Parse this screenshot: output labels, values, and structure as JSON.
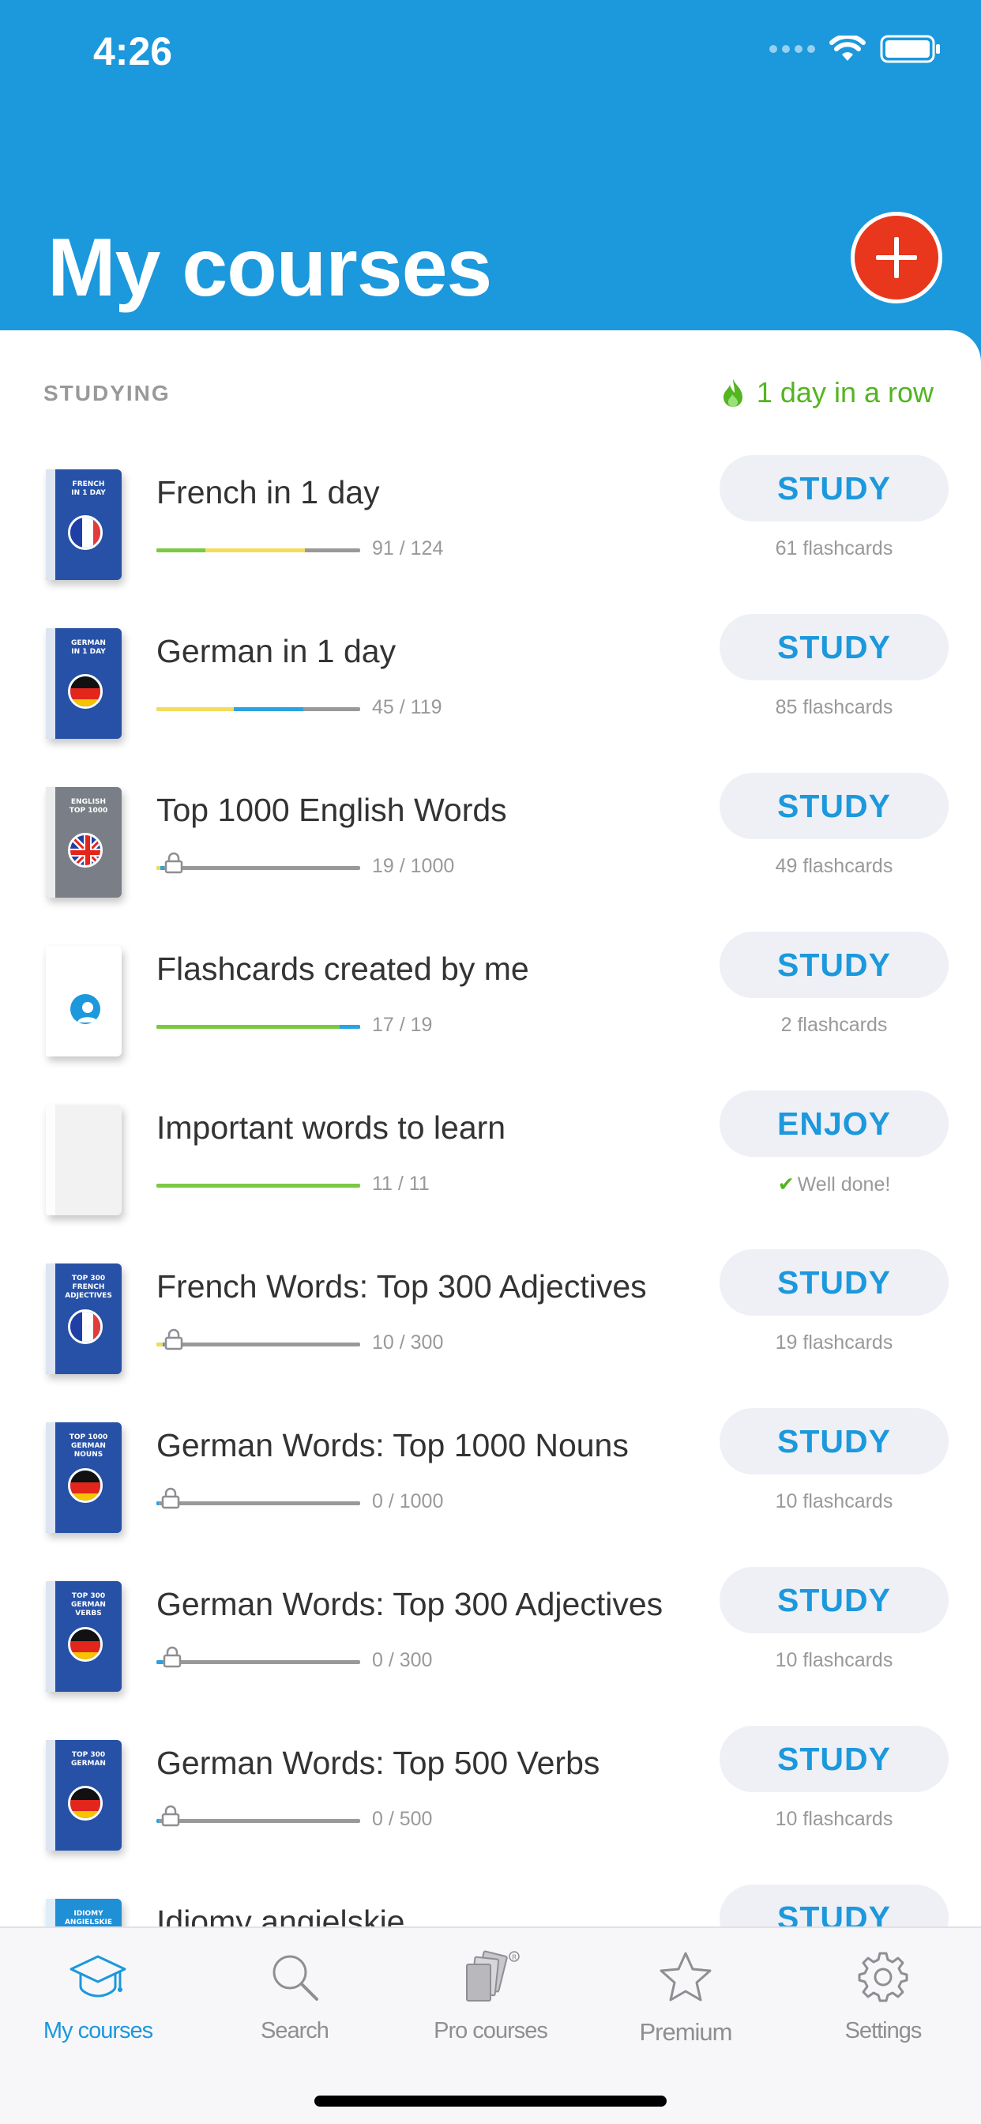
{
  "status_bar": {
    "time": "4:26"
  },
  "header": {
    "title": "My courses",
    "add_icon": "plus-icon"
  },
  "section": {
    "label": "STUDYING",
    "streak": "1 day in a row",
    "streak_color": "#53b51f"
  },
  "courses": [
    {
      "name": "French in 1 day",
      "count": "91 / 124",
      "action": "STUDY",
      "sub": "61 flashcards",
      "cover": {
        "color": "#2651a6",
        "title": "FRENCH\nIN 1 DAY",
        "flag": "fr"
      },
      "progress": [
        {
          "c": "#7ac943",
          "f": 0.24
        },
        {
          "c": "#f3dc5b",
          "f": 0.49
        }
      ],
      "locked": false
    },
    {
      "name": "German in 1 day",
      "count": "45 / 119",
      "action": "STUDY",
      "sub": "85 flashcards",
      "cover": {
        "color": "#2651a6",
        "title": "GERMAN\nIN 1 DAY",
        "flag": "de"
      },
      "progress": [
        {
          "c": "#f3dc5b",
          "f": 0.38
        },
        {
          "c": "#2aa3e0",
          "f": 0.34
        }
      ],
      "locked": false
    },
    {
      "name": "Top 1000 English Words",
      "count": "19 / 1000",
      "action": "STUDY",
      "sub": "49 flashcards",
      "cover": {
        "color": "#7a7f87",
        "title": "ENGLISH\nTOP 1000",
        "flag": "uk"
      },
      "progress": [
        {
          "c": "#f3dc5b",
          "f": 0.02
        },
        {
          "c": "#2aa3e0",
          "f": 0.02
        }
      ],
      "locked": true
    },
    {
      "name": "Flashcards created by me",
      "count": "17 / 19",
      "action": "STUDY",
      "sub": "2 flashcards",
      "cover": {
        "color": "#ffffff",
        "title": "",
        "flag": "user"
      },
      "progress": [
        {
          "c": "#7ac943",
          "f": 0.9
        },
        {
          "c": "#2aa3e0",
          "f": 0.1
        }
      ],
      "locked": false
    },
    {
      "name": "Important words to learn",
      "count": "11 / 11",
      "action": "ENJOY",
      "sub": "Well done!",
      "done": true,
      "cover": {
        "color": "#f2f2f2",
        "title": "",
        "flag": "none"
      },
      "progress": [
        {
          "c": "#7ac943",
          "f": 1.0
        }
      ],
      "locked": false
    },
    {
      "name": "French Words: Top 300 Adjectives",
      "count": "10 / 300",
      "action": "STUDY",
      "sub": "19 flashcards",
      "cover": {
        "color": "#2651a6",
        "title": "TOP 300\nFRENCH\nADJECTIVES",
        "flag": "fr"
      },
      "progress": [
        {
          "c": "#f3dc5b",
          "f": 0.03
        },
        {
          "c": "#2aa3e0",
          "f": 0.01
        }
      ],
      "locked": true
    },
    {
      "name": "German Words: Top 1000 Nouns",
      "count": "0 / 1000",
      "action": "STUDY",
      "sub": "10 flashcards",
      "cover": {
        "color": "#2651a6",
        "title": "TOP 1000\nGERMAN\nNOUNS",
        "flag": "de"
      },
      "progress": [
        {
          "c": "#2aa3e0",
          "f": 0.01
        }
      ],
      "locked": true
    },
    {
      "name": "German Words: Top 300 Adjectives",
      "count": "0 / 300",
      "action": "STUDY",
      "sub": "10 flashcards",
      "cover": {
        "color": "#2651a6",
        "title": "TOP 300\nGERMAN\nVERBS",
        "flag": "de"
      },
      "progress": [
        {
          "c": "#2aa3e0",
          "f": 0.03
        }
      ],
      "locked": true
    },
    {
      "name": "German Words: Top 500 Verbs",
      "count": "0 / 500",
      "action": "STUDY",
      "sub": "10 flashcards",
      "cover": {
        "color": "#2651a6",
        "title": "TOP 300\nGERMAN",
        "flag": "de"
      },
      "progress": [
        {
          "c": "#2aa3e0",
          "f": 0.01
        }
      ],
      "locked": true
    },
    {
      "name": "Idiomy angielskie",
      "count": "",
      "action": "STUDY",
      "sub": "",
      "cover": {
        "color": "#1f8fd6",
        "title": "IDIOMY\nANGIELSKIE",
        "flag": "uk"
      },
      "progress": [],
      "locked": false
    }
  ],
  "tabbar": {
    "tabs": [
      {
        "label": "My courses",
        "icon": "graduation-cap-icon",
        "active": true
      },
      {
        "label": "Search",
        "icon": "search-icon",
        "active": false
      },
      {
        "label": "Pro courses",
        "icon": "books-icon",
        "active": false
      },
      {
        "label": "Premium",
        "icon": "star-icon",
        "active": false
      },
      {
        "label": "Settings",
        "icon": "gear-icon",
        "active": false
      }
    ]
  },
  "colors": {
    "brand": "#1c98dc",
    "add_button": "#e8371c",
    "success": "#53b51f"
  }
}
